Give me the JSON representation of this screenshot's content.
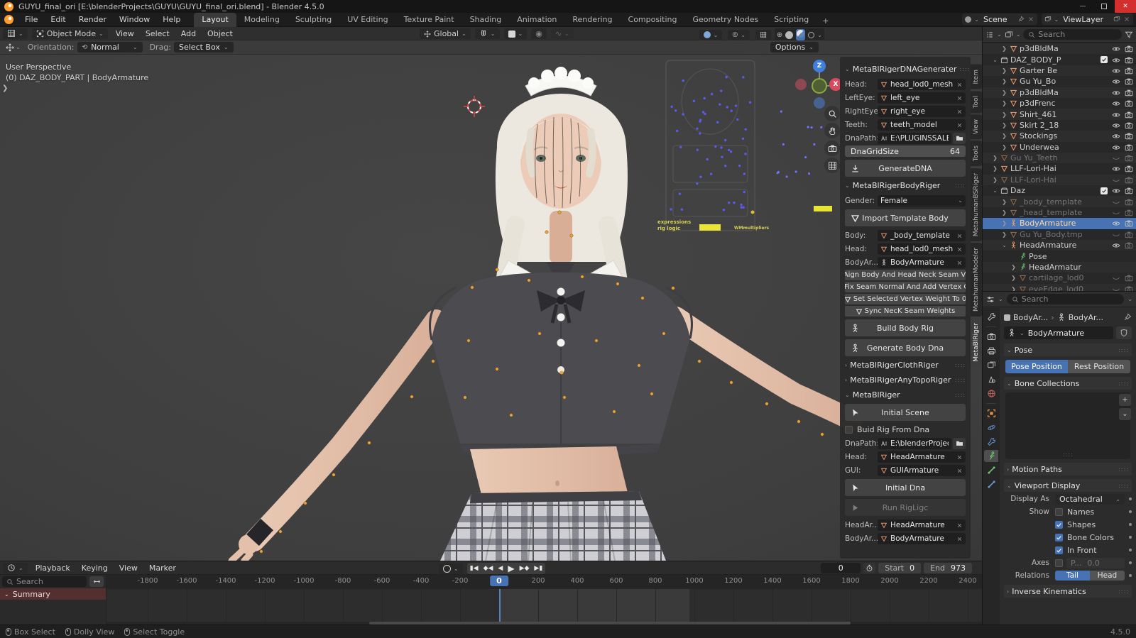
{
  "colors": {
    "accent_blue": "#4772b3",
    "active_orange": "#ffd9a6",
    "mesh_icon": "#e0936b",
    "viewport_bg": "#424242",
    "summary_red": "#53302f",
    "gui_yellow": "#e8e337"
  },
  "titlebar": {
    "title": "GUYU_final_ori [E:\\blenderProjects\\GUYU\\GUYU_final_ori.blend] - Blender 4.5.0"
  },
  "topbar": {
    "menus": [
      "File",
      "Edit",
      "Render",
      "Window",
      "Help"
    ],
    "workspaces": [
      "Layout",
      "Modeling",
      "Sculpting",
      "UV Editing",
      "Texture Paint",
      "Shading",
      "Animation",
      "Rendering",
      "Compositing",
      "Geometry Nodes",
      "Scripting"
    ],
    "active_workspace": "Layout",
    "new_workspace": "+",
    "scene": "Scene",
    "view_layer": "ViewLayer"
  },
  "viewport": {
    "mode": "Object Mode",
    "menus": [
      "View",
      "Select",
      "Add",
      "Object"
    ],
    "transform_orientation": "Global",
    "tool_settings": {
      "orientation_label": "Orientation:",
      "orientation": "Normal",
      "drag_label": "Drag:",
      "drag": "Select Box",
      "options": "Options"
    },
    "overlay": {
      "line1": "User Perspective",
      "line2": "(0) DAZ_BODY_PART | BodyArmature"
    },
    "gizmo": {
      "z": "Z",
      "x": "X"
    },
    "gui_board": {
      "label_line1": "expressions",
      "label_line2": "rig logic",
      "label_right": "WMmultipliers"
    },
    "sidebar_tabs": [
      "Item",
      "Tool",
      "View",
      "Tools",
      "MetahumanBSRiger",
      "MetahumanModeler",
      "MetaBlRiger"
    ],
    "active_sidebar_tab": "MetaBlRiger"
  },
  "npanel": {
    "dna": {
      "title": "MetaBlRigerDNAGenerater",
      "fields": [
        {
          "label": "Head:",
          "value": "head_lod0_mesh",
          "icon": "mesh"
        },
        {
          "label": "LeftEye:",
          "value": "left_eye",
          "icon": "mesh"
        },
        {
          "label": "RightEye:",
          "value": "right_eye",
          "icon": "mesh"
        },
        {
          "label": "Teeth:",
          "value": "teeth_model",
          "icon": "mesh"
        }
      ],
      "dna_path_label": "DnaPath:",
      "dna_path": "E:\\PLUGINSSALE\\M...",
      "grid_size_label": "DnaGridSize",
      "grid_size": "64",
      "generate": "GenerateDNA"
    },
    "body": {
      "title": "MetaBlRigerBodyRiger",
      "gender_label": "Gender:",
      "gender": "Female",
      "import_template": "Import Template Body",
      "fields": [
        {
          "label": "Body:",
          "value": "_body_template",
          "icon": "mesh"
        },
        {
          "label": "Head:",
          "value": "head_lod0_mesh",
          "icon": "mesh"
        },
        {
          "label": "BodyAr...",
          "value": "BodyArmature",
          "icon": "armature"
        }
      ],
      "ops": [
        "Aign Body And Head Neck Seam Ve...",
        "Fix Seam Normal And Add Vertex C...",
        "Set Selected Vertex Weight To 0",
        "Sync NecK Seam Weights"
      ],
      "build": "Build Body Rig",
      "generate": "Generate Body Dna"
    },
    "collapsed_panels": [
      "MetaBlRigerClothRiger",
      "MetaBlRigerAnyTopoRiger"
    ],
    "riger": {
      "title": "MetaBlRiger",
      "initial_scene": "Initial Scene",
      "build_from_dna": "Buid Rig From Dna",
      "dna_path_label": "DnaPath:",
      "dna_path": "E:\\blenderProjects\\...",
      "fields": [
        {
          "label": "Head:",
          "value": "HeadArmature",
          "icon": "mesh"
        },
        {
          "label": "GUI:",
          "value": "GUIArmature",
          "icon": "mesh"
        }
      ],
      "initial_dna": "Initial Dna",
      "run_rig": "Run RigLigc",
      "tail_fields": [
        {
          "label": "HeadAr...",
          "value": "HeadArmature",
          "icon": "mesh"
        },
        {
          "label": "BodyAr...",
          "value": "BodyArmature",
          "icon": "mesh"
        }
      ]
    }
  },
  "outliner": {
    "search_placeholder": "Search",
    "rows": [
      {
        "label": "p3dBldMa",
        "icon": "mesh",
        "indent": 2,
        "arrow": "closed",
        "eye": "open",
        "cam": "on"
      },
      {
        "label": "DAZ_BODY_P",
        "icon": "collection",
        "indent": 1,
        "arrow": "open",
        "checkbox": true,
        "eye": "open",
        "cam": "on"
      },
      {
        "label": "Garter Be",
        "icon": "mesh",
        "indent": 2,
        "arrow": "closed",
        "eye": "open",
        "cam": "on"
      },
      {
        "label": "Gu Yu_Bo",
        "icon": "mesh",
        "indent": 2,
        "arrow": "closed",
        "eye": "open",
        "cam": "on"
      },
      {
        "label": "p3dBldMa",
        "icon": "mesh",
        "indent": 2,
        "arrow": "closed",
        "eye": "open",
        "cam": "on"
      },
      {
        "label": "p3dFrenc",
        "icon": "mesh",
        "indent": 2,
        "arrow": "closed",
        "eye": "open",
        "cam": "on"
      },
      {
        "label": "Shirt_461",
        "icon": "mesh",
        "indent": 2,
        "arrow": "closed",
        "eye": "open",
        "cam": "on"
      },
      {
        "label": "Skirt 2_18",
        "icon": "mesh",
        "indent": 2,
        "arrow": "closed",
        "eye": "open",
        "cam": "on"
      },
      {
        "label": "Stockings",
        "icon": "mesh",
        "indent": 2,
        "arrow": "closed",
        "eye": "open",
        "cam": "on"
      },
      {
        "label": "Underwea",
        "icon": "mesh",
        "indent": 2,
        "arrow": "closed",
        "eye": "open",
        "cam": "on"
      },
      {
        "label": "Gu Yu_Teeth",
        "icon": "mesh",
        "indent": 1,
        "arrow": "closed",
        "dim": true,
        "eye": "closed",
        "cam": "off"
      },
      {
        "label": "LLF-Lori-Hai",
        "icon": "mesh",
        "indent": 1,
        "arrow": "closed",
        "eye": "open",
        "cam": "on"
      },
      {
        "label": "LLF-Lori-Hai",
        "icon": "mesh",
        "indent": 1,
        "arrow": "closed",
        "dim": true,
        "eye": "closed",
        "cam": "off"
      },
      {
        "label": "Daz",
        "icon": "collection",
        "indent": 1,
        "arrow": "open",
        "checkbox": true,
        "eye": "open",
        "cam": "on"
      },
      {
        "label": "_body_template",
        "icon": "mesh",
        "indent": 2,
        "arrow": "closed",
        "dim": true,
        "eye": "closed",
        "cam": "off"
      },
      {
        "label": "_head_template",
        "icon": "mesh",
        "indent": 2,
        "arrow": "closed",
        "dim": true,
        "eye": "closed",
        "cam": "off"
      },
      {
        "label": "BodyArmature",
        "icon": "armature",
        "indent": 2,
        "arrow": "closed",
        "selected": true,
        "eye": "open",
        "cam": "on"
      },
      {
        "label": "Gu Yu_Body.tmp",
        "icon": "mesh",
        "indent": 2,
        "arrow": "closed",
        "dim": true,
        "eye": "closed",
        "cam": "off"
      },
      {
        "label": "HeadArmature",
        "icon": "armature",
        "indent": 2,
        "arrow": "open",
        "eye": "open",
        "cam": "off"
      },
      {
        "label": "Pose",
        "icon": "pose",
        "indent": 3,
        "arrow": "none"
      },
      {
        "label": "HeadArmatur",
        "icon": "pose",
        "indent": 3,
        "arrow": "closed"
      },
      {
        "label": "cartilage_lod0",
        "icon": "mesh",
        "indent": 3,
        "arrow": "closed",
        "dim": true,
        "eye": "closed",
        "cam": "off"
      },
      {
        "label": "eyeEdge_lod0",
        "icon": "mesh",
        "indent": 3,
        "arrow": "closed",
        "dim": true,
        "eye": "closed",
        "cam": "off"
      }
    ]
  },
  "properties": {
    "search_placeholder": "Search",
    "breadcrumb": {
      "object": "BodyAr...",
      "data": "BodyAr..."
    },
    "name": "BodyArmature",
    "tabs": [
      "tool",
      "render",
      "output",
      "view-layer",
      "scene",
      "world",
      "object",
      "physics",
      "constraints",
      "data",
      "bone",
      "bone-constraint"
    ],
    "active_tab": "data",
    "pose_panel": {
      "title": "Pose",
      "pose_position": "Pose Position",
      "rest_position": "Rest Position"
    },
    "bone_collections": {
      "title": "Bone Collections",
      "add": "+",
      "menu": "⌄"
    },
    "motion_paths": "Motion Paths",
    "viewport_display": {
      "title": "Viewport Display",
      "display_as_label": "Display As",
      "display_as": "Octahedral",
      "show_label": "Show",
      "checkboxes": [
        {
          "label": "Names",
          "checked": false
        },
        {
          "label": "Shapes",
          "checked": true
        },
        {
          "label": "Bone Colors",
          "checked": true
        },
        {
          "label": "In Front",
          "checked": true
        }
      ],
      "axes_label": "Axes",
      "axes_field_label": "P...",
      "axes_value": "0.0",
      "relations_label": "Relations",
      "tail": "Tail",
      "head": "Head",
      "active_relation": "Tail"
    },
    "inverse_kinematics": "Inverse Kinematics"
  },
  "timeline": {
    "menus": [
      "Playback",
      "Keying",
      "View",
      "Marker"
    ],
    "search_placeholder": "Search",
    "summary": "Summary",
    "current_frame": "0",
    "start_label": "Start",
    "start": "0",
    "end_label": "End",
    "end": "973",
    "playhead_frame": "0",
    "ticks": [
      -1800,
      -1600,
      -1400,
      -1200,
      -1000,
      -800,
      -600,
      -400,
      -200,
      0,
      200,
      400,
      600,
      800,
      1000,
      1200,
      1400,
      1600,
      1800,
      2000,
      2200,
      2400
    ],
    "frame_range": {
      "start": 0,
      "end": 973
    }
  },
  "statusbar": {
    "items": [
      "Box Select",
      "Dolly View",
      "Select Toggle"
    ],
    "version": "4.5.0"
  }
}
